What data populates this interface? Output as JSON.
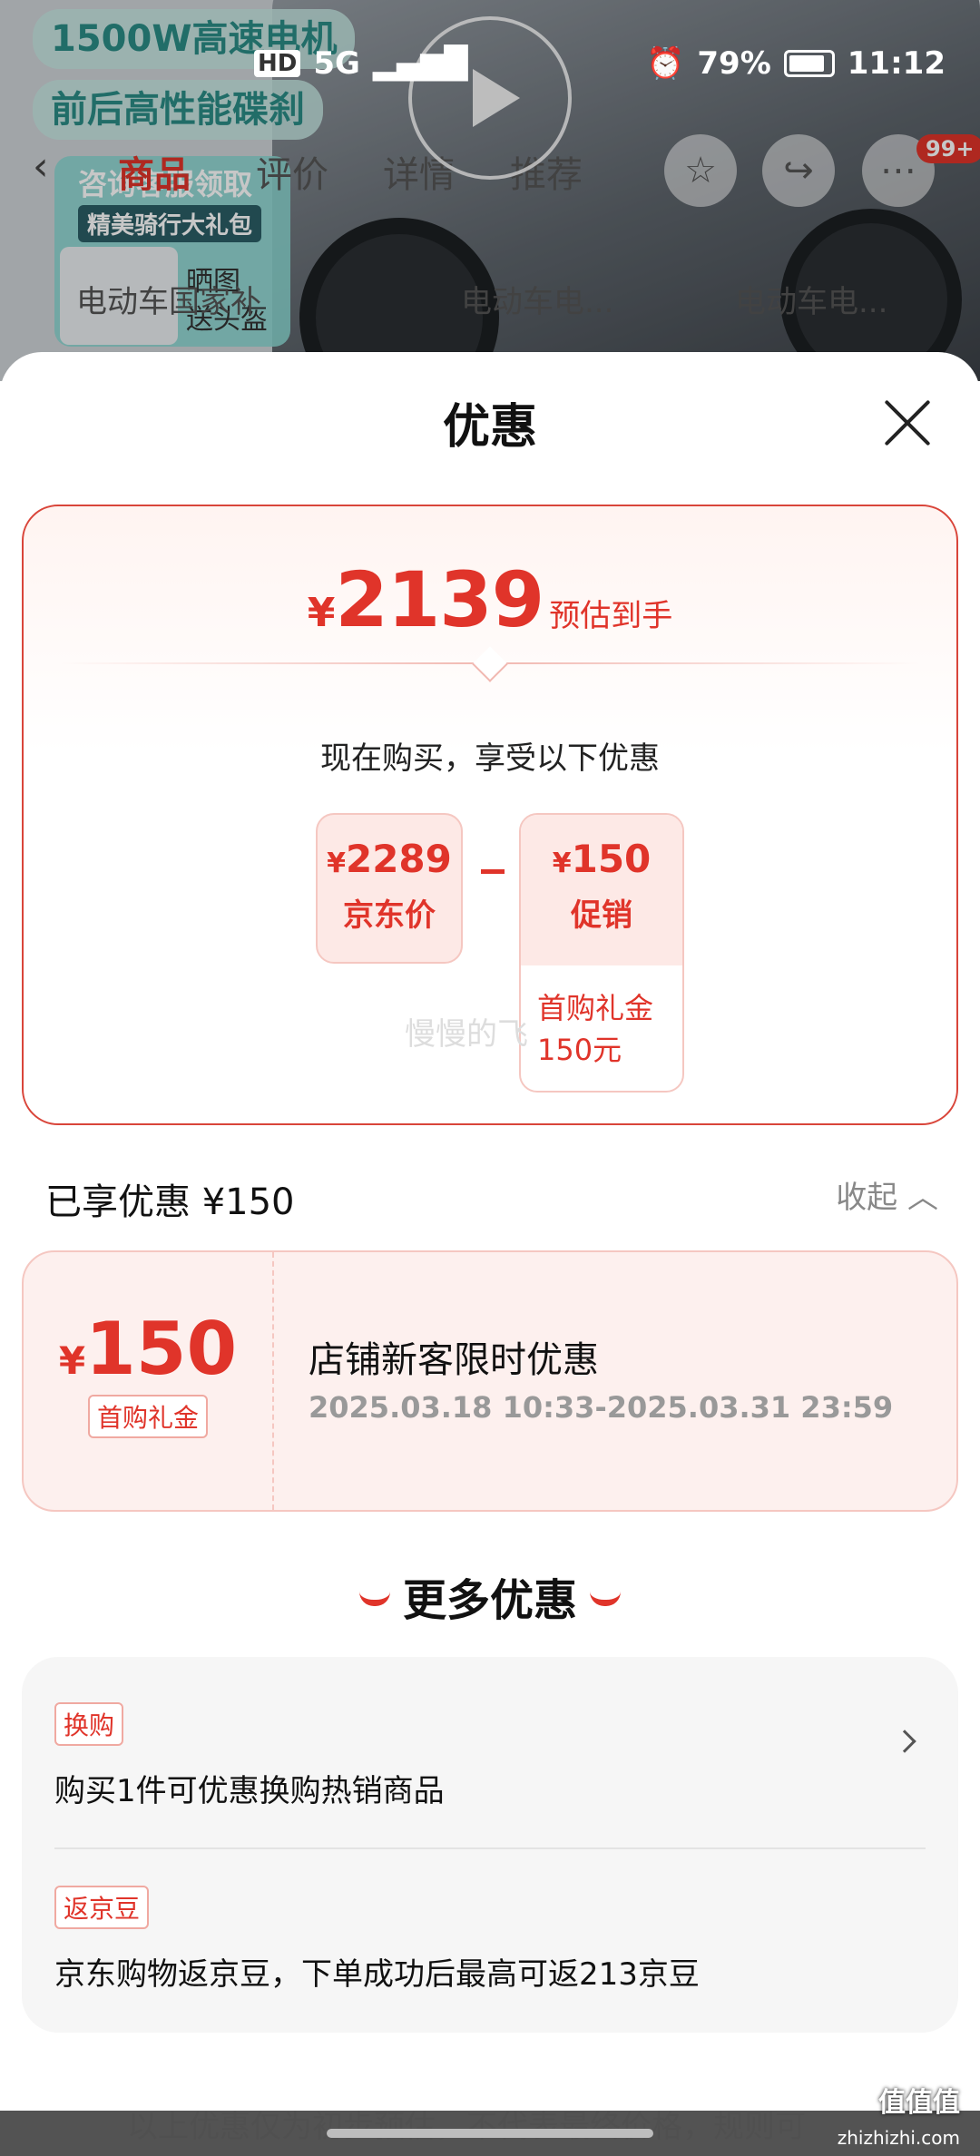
{
  "background": {
    "promo_line_1": "1500W高速电机",
    "promo_line_2": "前后高性能碟刹",
    "gift_title": "咨询客服领取",
    "gift_sub": "精美骑行大礼包",
    "gift_label_1": "晒图",
    "gift_label_2": "送头盔",
    "tabs": [
      "商品",
      "评价",
      "详情",
      "推荐"
    ],
    "cart_badge": "99+",
    "search_items": [
      "电动车国家补",
      "电动车电...",
      "电动车电..."
    ]
  },
  "status_bar": {
    "battery": "79%",
    "time": "11:12",
    "signal": "5G"
  },
  "sheet": {
    "title": "优惠",
    "summary": {
      "currency": "¥",
      "final_price": "2139",
      "final_label": "预估到手",
      "enjoy_text": "现在购买，享受以下优惠",
      "jd_price": "2289",
      "jd_price_label": "京东价",
      "promo_amount": "150",
      "promo_label": "促销",
      "promo_detail_line1": "首购礼金",
      "promo_detail_line2": "150元",
      "watermark": "慢慢的飞"
    },
    "enjoyed": {
      "title": "已享优惠 ¥150",
      "collapse_label": "收起"
    },
    "coupon": {
      "currency": "¥",
      "amount": "150",
      "tag": "首购礼金",
      "name": "店铺新客限时优惠",
      "time_range": "2025.03.18 10:33-2025.03.31 23:59"
    },
    "more": {
      "title": "更多优惠",
      "items": [
        {
          "tag": "换购",
          "desc": "购买1件可优惠换购热销商品"
        },
        {
          "tag": "返京豆",
          "desc": "京东购物返京豆，下单成功后最高可返213京豆"
        }
      ]
    },
    "footnote": "以上优惠仅为初步预估，不代表最终价格，规则可"
  },
  "corner": {
    "logo": "值值值",
    "url": "zhizhizhi.com"
  },
  "colors": {
    "accent": "#e0342a",
    "coupon_bg": "#fdf0ee"
  }
}
